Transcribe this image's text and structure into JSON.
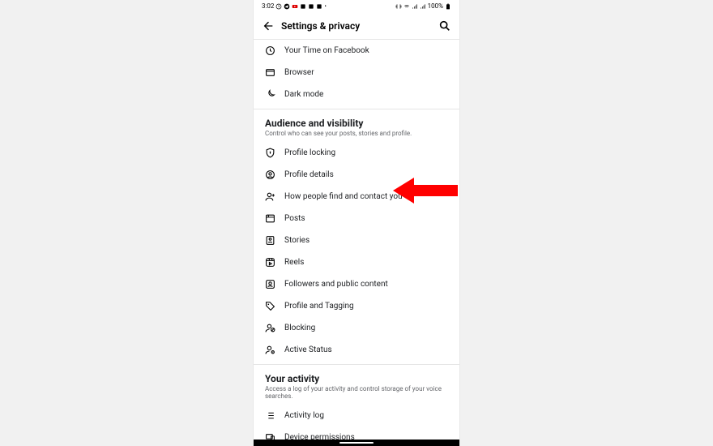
{
  "statusbar": {
    "time": "3:02",
    "battery": "100%"
  },
  "appbar": {
    "title": "Settings & privacy"
  },
  "top_items": [
    {
      "label": "Your Time on Facebook"
    },
    {
      "label": "Browser"
    },
    {
      "label": "Dark mode"
    }
  ],
  "sections": [
    {
      "title": "Audience and visibility",
      "sub": "Control who can see your posts, stories and profile.",
      "items": [
        {
          "label": "Profile locking"
        },
        {
          "label": "Profile details"
        },
        {
          "label": "How people find and contact you"
        },
        {
          "label": "Posts"
        },
        {
          "label": "Stories"
        },
        {
          "label": "Reels"
        },
        {
          "label": "Followers and public content"
        },
        {
          "label": "Profile and Tagging"
        },
        {
          "label": "Blocking"
        },
        {
          "label": "Active Status"
        }
      ]
    },
    {
      "title": "Your activity",
      "sub": "Access a log of your activity and control storage of your voice searches.",
      "items": [
        {
          "label": "Activity log"
        },
        {
          "label": "Device permissions"
        }
      ]
    }
  ],
  "annotation": {
    "color": "#ff0000"
  }
}
